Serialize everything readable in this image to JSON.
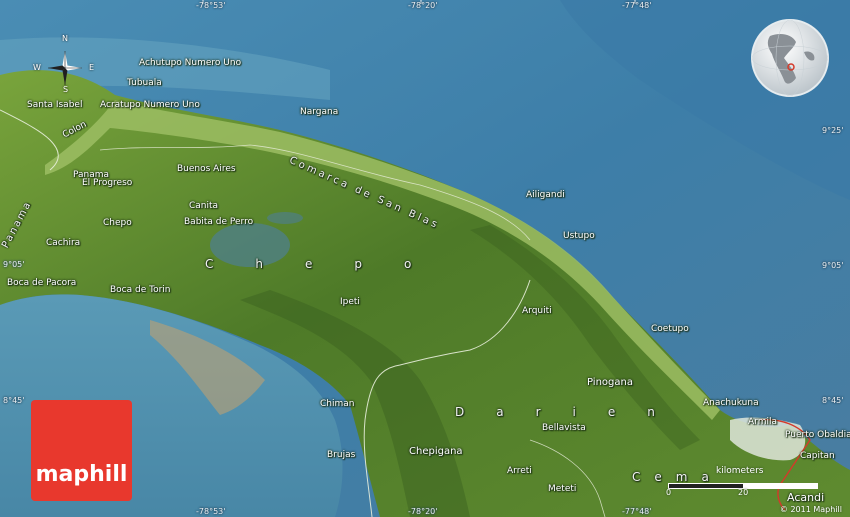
{
  "brand": {
    "logo_text": "maphill",
    "copyright": "© 2011 Maphill"
  },
  "colors": {
    "sea_deep": "#2f6f9a",
    "sea_shallow": "#5a9bbb",
    "land": "#5d8a2e",
    "coast": "#c8d9a0",
    "logo": "#e8382d",
    "route": "#d43a2a"
  },
  "coordinates": {
    "top": [
      "-78°53'",
      "-78°20'",
      "-77°48'"
    ],
    "bottom": [
      "-78°53'",
      "-78°20'",
      "-77°48'"
    ],
    "left": [
      "9°05'",
      "8°45'"
    ],
    "right": [
      "9°25'",
      "9°05'",
      "8°45'"
    ]
  },
  "compass": {
    "n": "N",
    "s": "S",
    "e": "E",
    "w": "W"
  },
  "places": {
    "achutupo": "Achutupo Numero Uno",
    "tubuala": "Tubuala",
    "acratupo": "Acratupo Numero Uno",
    "santa_isabel": "Santa Isabel",
    "colon": "Colon",
    "nargana": "Nargana",
    "comarca": "Comarca de San Blas",
    "panama_label": "Panama",
    "el_progreso": "El Progreso",
    "buenos_aires": "Buenos Aires",
    "ailigandi": "Ailigandi",
    "panama_region": "Panama",
    "chepo_town": "Chepo",
    "canita": "Canita",
    "babita": "Babita de Perro",
    "ustupo": "Ustupo",
    "cachira": "Cachira",
    "chepo_region": "Chepo",
    "boca_pacora": "Boca de Pacora",
    "boca_torin": "Boca de Torin",
    "ipeti": "Ipeti",
    "arquiti": "Arquiti",
    "coetupo": "Coetupo",
    "pinogana": "Pinogana",
    "anachukuna": "Anachukuna",
    "chiman": "Chiman",
    "darien_region": "Darien",
    "bellavista": "Bellavista",
    "armila": "Armila",
    "puerto_obaldia": "Puerto Obaldia",
    "capitan": "Capitan",
    "brujas": "Brujas",
    "chepigana": "Chepigana",
    "arreti": "Arreti",
    "cemaco": "Cema",
    "meteti": "Meteti",
    "acandi": "Acandi"
  },
  "scale": {
    "title": "kilometers",
    "ticks": [
      "0",
      "20"
    ]
  }
}
